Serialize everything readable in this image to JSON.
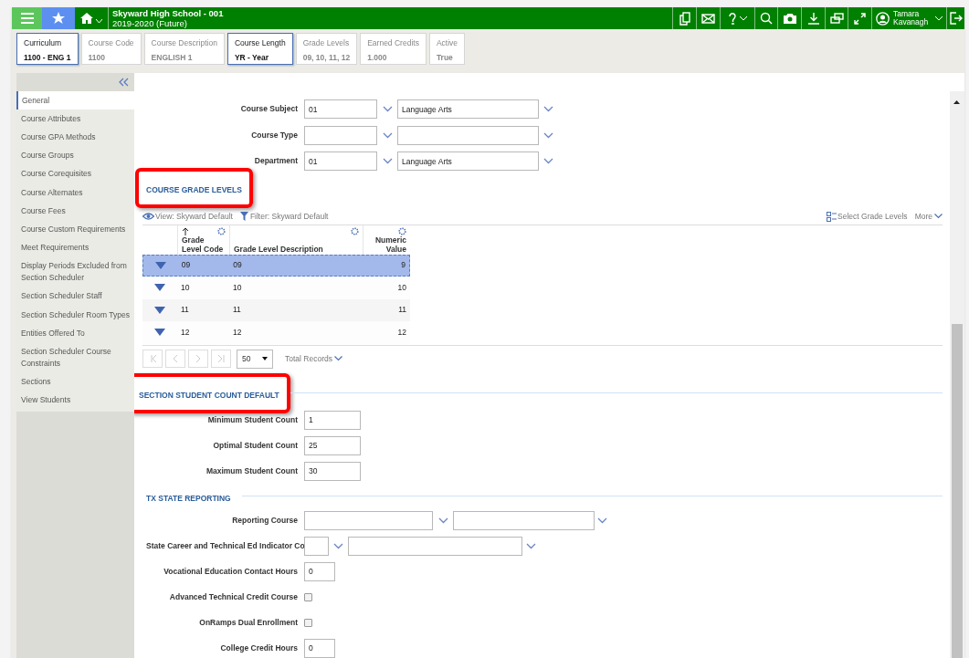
{
  "header": {
    "school": "Skyward High School - 001",
    "year": "2019-2020 (Future)",
    "user": "Tamara Kavanagh"
  },
  "summary_cards": [
    {
      "label": "Curriculum",
      "value": "1100 - ENG 1",
      "selected": true
    },
    {
      "label": "Course Code",
      "value": "1100",
      "selected": false
    },
    {
      "label": "Course Description",
      "value": "ENGLISH 1",
      "selected": false
    },
    {
      "label": "Course Length",
      "value": "YR - Year",
      "selected": true
    },
    {
      "label": "Grade Levels",
      "value": "09, 10, 11, 12",
      "selected": false
    },
    {
      "label": "Earned Credits",
      "value": "1.000",
      "selected": false
    },
    {
      "label": "Active",
      "value": "True",
      "selected": false
    }
  ],
  "sidebar": {
    "items": [
      {
        "label": "General",
        "selected": true
      },
      {
        "label": "Course Attributes",
        "selected": false
      },
      {
        "label": "Course GPA Methods",
        "selected": false
      },
      {
        "label": "Course Groups",
        "selected": false
      },
      {
        "label": "Course Corequisites",
        "selected": false
      },
      {
        "label": "Course Alternates",
        "selected": false
      },
      {
        "label": "Course Fees",
        "selected": false
      },
      {
        "label": "Course Custom Requirements",
        "selected": false
      },
      {
        "label": "Meet Requirements",
        "selected": false
      },
      {
        "label": "Display Periods Excluded from Section Scheduler",
        "selected": false
      },
      {
        "label": "Section Scheduler Staff",
        "selected": false
      },
      {
        "label": "Section Scheduler Room Types",
        "selected": false
      },
      {
        "label": "Entities Offered To",
        "selected": false
      },
      {
        "label": "Section Scheduler Course Constraints",
        "selected": false
      },
      {
        "label": "Sections",
        "selected": false
      },
      {
        "label": "View Students",
        "selected": false
      }
    ]
  },
  "course_fields": [
    {
      "label": "Course Subject",
      "code": "01",
      "description": "Language Arts"
    },
    {
      "label": "Course Type"
    },
    {
      "label": "Department",
      "code": "01",
      "description": "Language Arts"
    }
  ],
  "grade_levels": {
    "title": "COURSE GRADE LEVELS",
    "highlighted": true,
    "view": "View: Skyward Default",
    "filter": "Filter: Skyward Default",
    "select_action": "Select Grade Levels",
    "more": "More",
    "columns": [
      "Grade Level Code",
      "Grade Level Description",
      "Numeric Value"
    ],
    "rows": [
      {
        "cells": [
          "09",
          "09",
          "9"
        ],
        "selected": true
      },
      {
        "cells": [
          "10",
          "10",
          "10"
        ],
        "selected": false
      },
      {
        "cells": [
          "11",
          "11",
          "11"
        ],
        "selected": false
      },
      {
        "cells": [
          "12",
          "12",
          "12"
        ],
        "selected": false
      }
    ],
    "page_size": "50",
    "total_records": "Total Records"
  },
  "student_count": {
    "title": "SECTION STUDENT COUNT DEFAULT",
    "highlighted": true,
    "fields": [
      {
        "label": "Minimum Student Count",
        "value": "1"
      },
      {
        "label": "Optimal Student Count",
        "value": "25"
      },
      {
        "label": "Maximum Student Count",
        "value": "30"
      }
    ]
  },
  "tx_state_reporting": {
    "title": "TX STATE REPORTING",
    "highlighted": false,
    "fields": [
      {
        "kind": "double_select",
        "label": "Reporting Course"
      },
      {
        "kind": "short_select",
        "label": "State Career and Technical Ed Indicator Co"
      },
      {
        "kind": "input",
        "label": "Vocational Education Contact Hours",
        "value": "0"
      },
      {
        "kind": "checkbox",
        "label": "Advanced Technical Credit Course",
        "checked": false
      },
      {
        "kind": "checkbox",
        "label": "OnRamps Dual Enrollment",
        "checked": false
      },
      {
        "kind": "input",
        "label": "College Credit Hours",
        "value": "0"
      }
    ]
  }
}
